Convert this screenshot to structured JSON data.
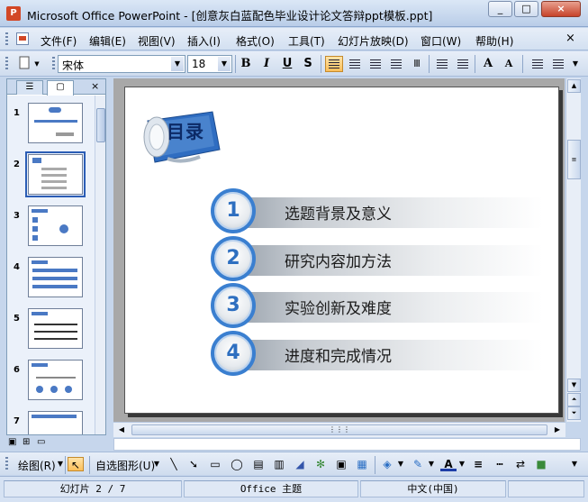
{
  "window": {
    "title": "Microsoft Office PowerPoint - [创意灰白蓝配色毕业设计论文答辩ppt模板.ppt]",
    "minimize": "_",
    "restore": "□",
    "close": "×"
  },
  "menu": {
    "items": [
      "文件(F)",
      "编辑(E)",
      "视图(V)",
      "插入(I)",
      "格式(O)",
      "工具(T)",
      "幻灯片放映(D)",
      "窗口(W)",
      "帮助(H)"
    ],
    "close": "×"
  },
  "toolbar": {
    "font_name": "宋体",
    "font_size": "18",
    "bold": "B",
    "italic": "I",
    "underline": "U",
    "shadow": "S",
    "grow_font": "A",
    "shrink_font": "A"
  },
  "left_pane": {
    "tab_outline_icon": "outline-tab-icon",
    "tab_slides_icon": "slides-tab-icon",
    "close": "×",
    "slide_numbers": [
      "1",
      "2",
      "3",
      "4",
      "5",
      "6",
      "7"
    ],
    "selected_slide": 2
  },
  "slide": {
    "title": "目录",
    "items": [
      {
        "num": "1",
        "label": "选题背景及意义"
      },
      {
        "num": "2",
        "label": "研究内容加方法"
      },
      {
        "num": "3",
        "label": "实验创新及难度"
      },
      {
        "num": "4",
        "label": "进度和完成情况"
      }
    ],
    "accent_color": "#3a7fd0"
  },
  "drawing": {
    "draw_label": "绘图(R)",
    "autoshapes_label": "自选图形(U)"
  },
  "status": {
    "slide_info": "幻灯片 2 / 7",
    "theme": "Office 主题",
    "language": "中文(中国)"
  }
}
